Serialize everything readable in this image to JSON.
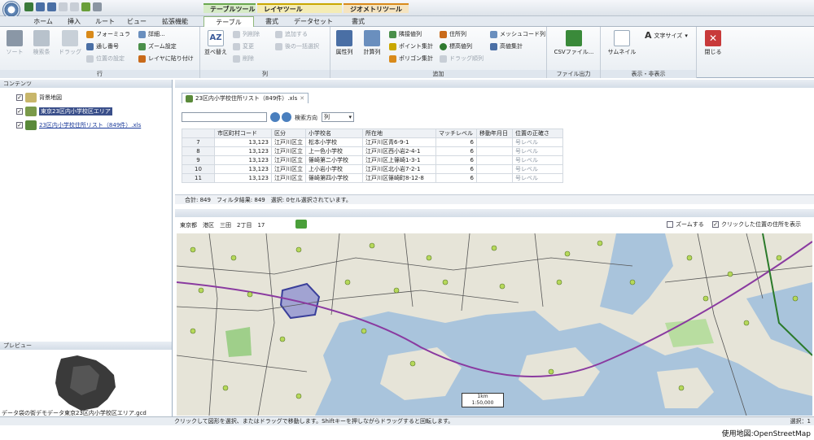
{
  "quick_access": {
    "icons": [
      "save-icon",
      "undo-icon",
      "redo-icon",
      "copy-icon",
      "paste-icon",
      "refresh-icon",
      "settings-icon"
    ]
  },
  "context_headers": {
    "table_tools": "テーブルツール",
    "layer_tools": "レイヤツール",
    "geometry_tools": "ジオメトリツール"
  },
  "tabs": [
    "ホーム",
    "挿入",
    "ルート",
    "ビュー",
    "拡張機能",
    "テーブル",
    "書式",
    "データセット",
    "書式"
  ],
  "ribbon": {
    "groups": [
      "行",
      "列",
      "追加",
      "ファイル出力",
      "表示・非表示"
    ],
    "row_group": {
      "btn1": "ソート",
      "btn2": "検索条",
      "btn3": "ドラッグ",
      "formula": "フォーミュラ",
      "fill": "通し番号",
      "blank_setting": "位置の設定",
      "detail": "詳細...",
      "zoom_setting": "ズーム設定",
      "paste_layer": "レイヤに貼り付け"
    },
    "col_group": {
      "sort_label": "並べ替え",
      "delete_col": "列削除",
      "change": "変更",
      "delete": "削除",
      "add_to": "追加する",
      "select_one": "後の一括選択"
    },
    "add_group": {
      "attr_col": "属性列",
      "calc_col": "計算列",
      "neighbor_value": "隣接値列",
      "point_agg": "ポイント集計",
      "polygon_agg": "ポリゴン集計",
      "address_col": "住所列",
      "coord_col": "標高値列",
      "draw_col": "ドラッグ順列",
      "mesh_code": "メッシュコード列",
      "max_value": "高値集計"
    },
    "file_output": {
      "csv": "CSVファイル..."
    },
    "show_hide": {
      "thumbnail": "サムネイル",
      "font_size": "文字サイズ"
    },
    "close": "閉じる"
  },
  "left_panel": {
    "contents_title": "コンテンツ",
    "layers": [
      {
        "label": "背景地図",
        "checked": true,
        "selected": false
      },
      {
        "label": "東京23区内小学校区エリア",
        "checked": true,
        "selected": true
      },
      {
        "label": "23区内小学校住所リスト（849件）.xls",
        "checked": true,
        "selected": false
      }
    ],
    "preview_title": "プレビュー",
    "preview_file": "データ袋の街デモデータ東京23区内小学校区エリア.gcd"
  },
  "table_view": {
    "tab_label": "23区内小学校住所リスト（849件）.xls",
    "search_label": "検索方向",
    "search_dir": "列",
    "columns": [
      "市区町村コード",
      "区分",
      "小学校名",
      "所在地",
      "マッチレベル",
      "移動年月日",
      "位置の正確さ"
    ],
    "rows": [
      {
        "num": "7",
        "cells": [
          "13,123",
          "江戸川区立",
          "松本小学校",
          "江戸川区青6-9-1",
          "6",
          "",
          "号レベル"
        ]
      },
      {
        "num": "8",
        "cells": [
          "13,123",
          "江戸川区立",
          "上一色小学校",
          "江戸川区西小岩2-4-1",
          "6",
          "",
          "号レベル"
        ]
      },
      {
        "num": "9",
        "cells": [
          "13,123",
          "江戸川区立",
          "篠崎第二小学校",
          "江戸川区上篠崎1-3-1",
          "6",
          "",
          "号レベル"
        ]
      },
      {
        "num": "10",
        "cells": [
          "13,123",
          "江戸川区立",
          "上小岩小学校",
          "江戸川区北小岩7-2-1",
          "6",
          "",
          "号レベル"
        ]
      },
      {
        "num": "11",
        "cells": [
          "13,123",
          "江戸川区立",
          "篠崎第四小学校",
          "江戸川区篠崎町8-12-8",
          "6",
          "",
          "号レベル"
        ]
      }
    ],
    "footer": "合計: 849　フィルタ結果: 849　選択: 0セル選択されています。"
  },
  "map_view": {
    "breadcrumb": "東京都　港区　三田　2丁目　17",
    "zoom_label": "ズームする",
    "address_label": "クリックした位置の住所を表示",
    "scale_top": "1km",
    "scale_bottom": "1:50,000"
  },
  "status_bar": {
    "left": "クリックして図形を選択、またはドラッグで移動します。Shiftキーを押しながらドラッグすると回転します。",
    "right": "選択：1"
  },
  "credit": "使用地図:OpenStreetMap"
}
